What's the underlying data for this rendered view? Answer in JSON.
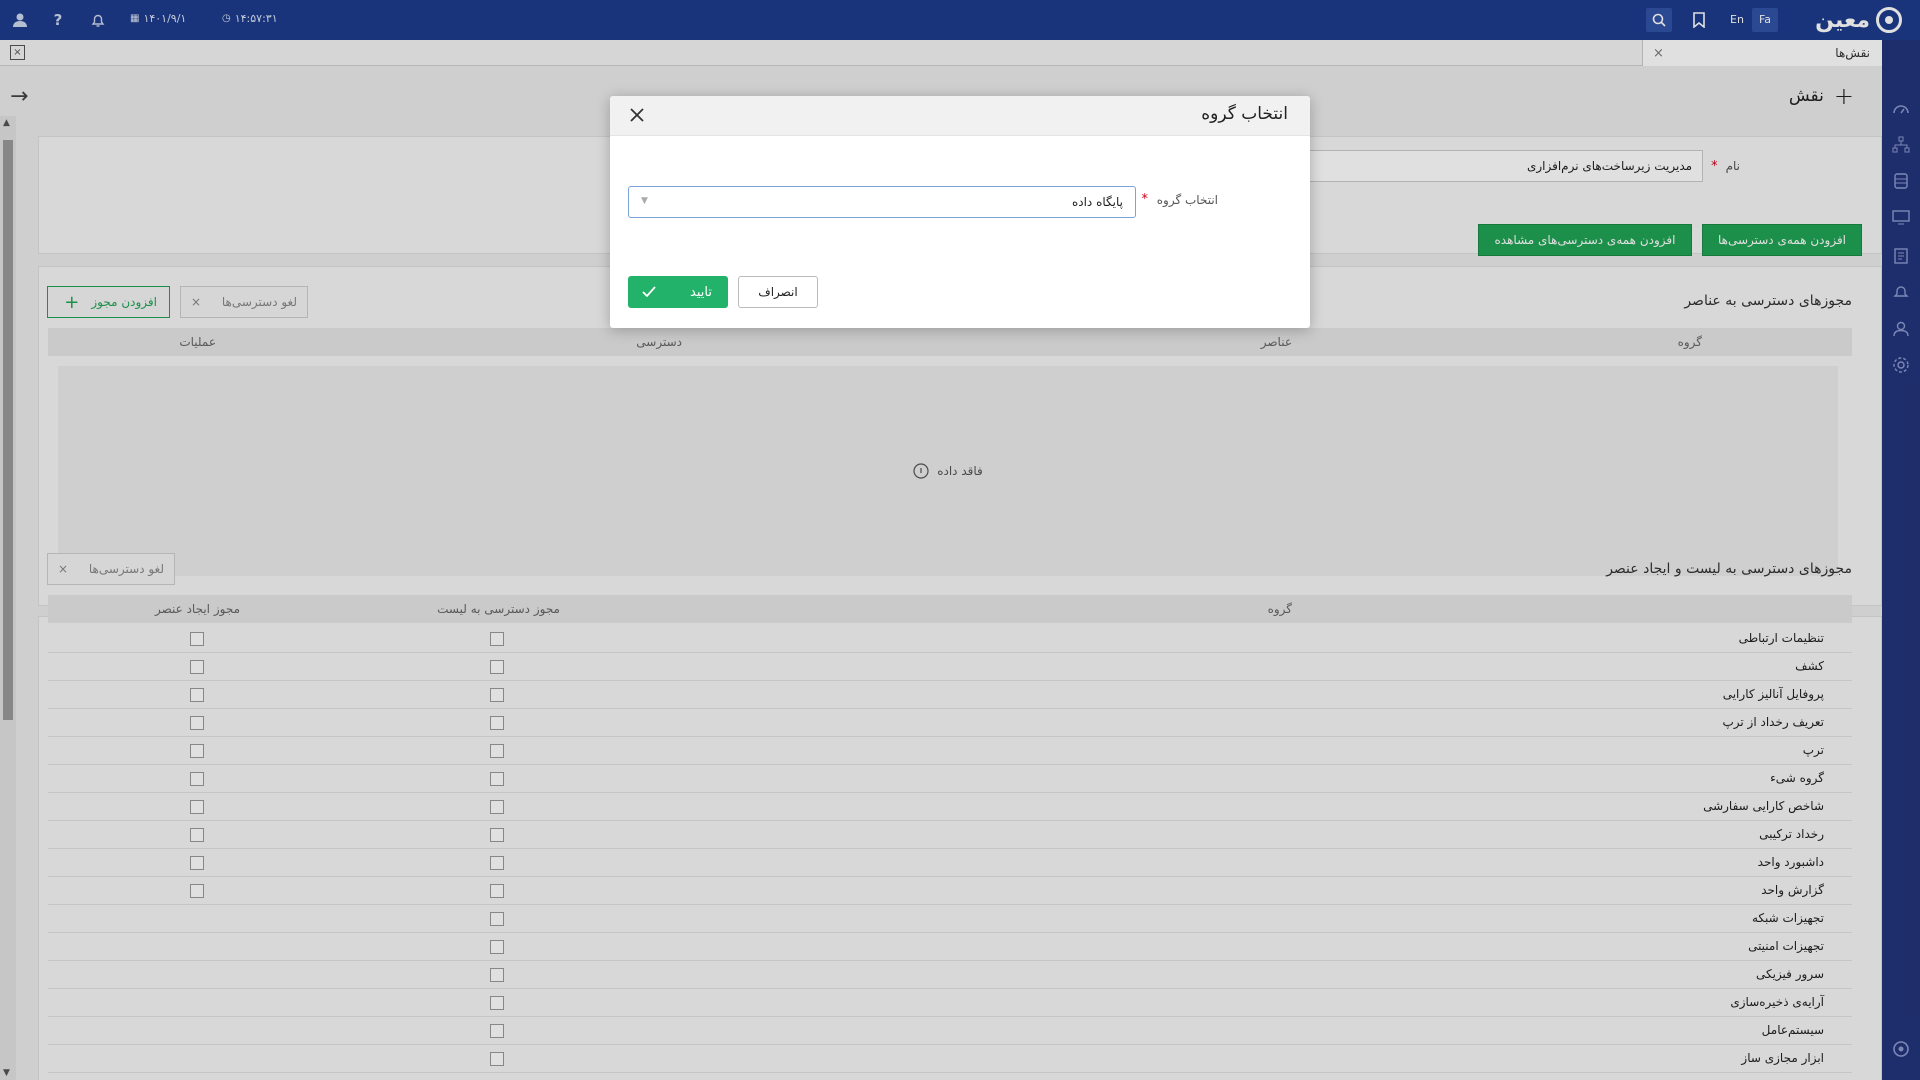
{
  "topbar": {
    "logo_text": "معین",
    "lang_fa": "Fa",
    "lang_en": "En",
    "time": "۱۴:۵۷:۳۱",
    "date": "۱۴۰۱/۹/۱"
  },
  "tabs": [
    {
      "label": "نقش‌ها",
      "close": "×"
    }
  ],
  "page": {
    "title": "نقش",
    "name_label": "نام",
    "name_value": "مدیریت زیرساخت‌های نرم‌افزاری",
    "btn_add_all": "افزودن همه‌ی دسترسی‌ها",
    "btn_add_all_view": "افزودن همه‌ی دسترسی‌های مشاهده"
  },
  "element_permissions": {
    "title": "مجوزهای دسترسی به عناصر",
    "revoke_label": "لغو دسترسی‌ها",
    "add_label": "افزودن مجوز",
    "columns": {
      "group": "گروه",
      "elements": "عناصر",
      "access": "دسترسی",
      "actions": "عملیات"
    },
    "empty_text": "فاقد داده"
  },
  "list_permissions": {
    "title": "مجوزهای دسترسی به لیست و ایجاد عنصر",
    "revoke_label": "لغو دسترسی‌ها",
    "columns": {
      "group": "گروه",
      "list_access": "مجوز دسترسی به لیست",
      "create_access": "مجوز ایجاد عنصر"
    },
    "rows": [
      {
        "label": "تنظیمات ارتباطی",
        "create_cb": true
      },
      {
        "label": "کشف",
        "create_cb": true
      },
      {
        "label": "پروفایل آنالیز کارایی",
        "create_cb": true
      },
      {
        "label": "تعریف رخداد از ترپ",
        "create_cb": true
      },
      {
        "label": "ترپ",
        "create_cb": true
      },
      {
        "label": "گروه شیء",
        "create_cb": true
      },
      {
        "label": "شاخص کارایی سفارشی",
        "create_cb": true
      },
      {
        "label": "رخداد ترکیبی",
        "create_cb": true
      },
      {
        "label": "داشبورد واحد",
        "create_cb": true
      },
      {
        "label": "گزارش واحد",
        "create_cb": true
      },
      {
        "label": "تجهیزات شبکه",
        "create_cb": false
      },
      {
        "label": "تجهیزات امنیتی",
        "create_cb": false
      },
      {
        "label": "سرور فیزیکی",
        "create_cb": false
      },
      {
        "label": "آرایه‌ی ذخیره‌سازی",
        "create_cb": false
      },
      {
        "label": "سیستم‌عامل",
        "create_cb": false
      },
      {
        "label": "ابزار مجازی ساز",
        "create_cb": false
      }
    ]
  },
  "modal": {
    "title": "انتخاب گروه",
    "field_label": "انتخاب گروه",
    "select_value": "پایگاه داده",
    "confirm_label": "تایید",
    "cancel_label": "انصراف"
  },
  "colors": {
    "topbar": "#1d3c8c",
    "sidebar": "#23347a",
    "accent_green": "#20a455",
    "confirm_green": "#22b26a"
  }
}
